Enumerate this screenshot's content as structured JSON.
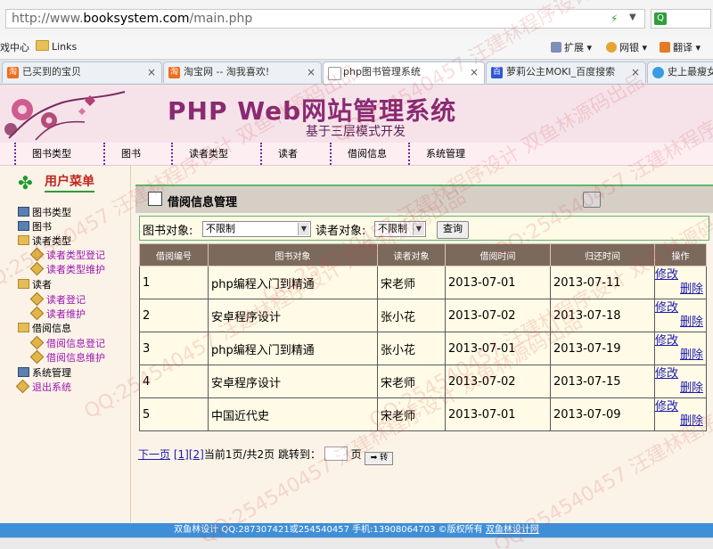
{
  "browser": {
    "url_prefix": "http://www.",
    "url_host": "booksystem.com",
    "url_path": "/main.php",
    "bookmarks": [
      {
        "label": "戏中心"
      },
      {
        "label": "Links"
      }
    ],
    "toolbar": [
      {
        "label": "扩展"
      },
      {
        "label": "网银"
      },
      {
        "label": "翻译"
      }
    ],
    "tabs": [
      {
        "label": "已买到的宝贝"
      },
      {
        "label": "淘宝网 -- 淘我喜欢!"
      },
      {
        "label": "php图书管理系统"
      },
      {
        "label": "萝莉公主MOKI_百度搜索"
      },
      {
        "label": "史上最瘦女"
      }
    ]
  },
  "banner": {
    "title": "PHP Web网站管理系统",
    "subtitle": "基于三层模式开发"
  },
  "nav": [
    "图书类型",
    "图书",
    "读者类型",
    "读者",
    "借阅信息",
    "系统管理"
  ],
  "sidebar": {
    "title": "用户菜单",
    "items": [
      {
        "label": "图书类型",
        "level": "top",
        "icon": "book"
      },
      {
        "label": "图书",
        "level": "top",
        "icon": "book"
      },
      {
        "label": "读者类型",
        "level": "top",
        "icon": "folder"
      },
      {
        "label": "读者类型登记",
        "level": "sub",
        "icon": "diamond"
      },
      {
        "label": "读者类型维护",
        "level": "sub",
        "icon": "diamond"
      },
      {
        "label": "读者",
        "level": "top",
        "icon": "folder"
      },
      {
        "label": "读者登记",
        "level": "sub",
        "icon": "diamond"
      },
      {
        "label": "读者维护",
        "level": "sub",
        "icon": "diamond"
      },
      {
        "label": "借阅信息",
        "level": "top",
        "icon": "folder"
      },
      {
        "label": "借阅信息登记",
        "level": "sub",
        "icon": "diamond"
      },
      {
        "label": "借阅信息维护",
        "level": "sub",
        "icon": "diamond"
      },
      {
        "label": "系统管理",
        "level": "top",
        "icon": "book"
      },
      {
        "label": "退出系统",
        "level": "exit",
        "icon": "diamond"
      }
    ]
  },
  "panel": {
    "title": "借阅信息管理",
    "filter": {
      "book_label": "图书对象:",
      "book_value": "不限制",
      "reader_label": "读者对象:",
      "reader_value": "不限制",
      "query_label": "查询"
    },
    "columns": [
      "借阅编号",
      "图书对象",
      "读者对象",
      "借阅时间",
      "归还时间",
      "操作"
    ],
    "rows": [
      {
        "id": "1",
        "book": "php编程入门到精通",
        "reader": "宋老师",
        "borrow": "2013-07-01",
        "return": "2013-07-11",
        "edit": "修改",
        "del": "删除"
      },
      {
        "id": "2",
        "book": "安卓程序设计",
        "reader": "张小花",
        "borrow": "2013-07-02",
        "return": "2013-07-18",
        "edit": "修改",
        "del": "删除"
      },
      {
        "id": "3",
        "book": "php编程入门到精通",
        "reader": "张小花",
        "borrow": "2013-07-01",
        "return": "2013-07-19",
        "edit": "修改",
        "del": "删除"
      },
      {
        "id": "4",
        "book": "安卓程序设计",
        "reader": "宋老师",
        "borrow": "2013-07-02",
        "return": "2013-07-15",
        "edit": "修改",
        "del": "删除"
      },
      {
        "id": "5",
        "book": "中国近代史",
        "reader": "宋老师",
        "borrow": "2013-07-01",
        "return": "2013-07-09",
        "edit": "修改",
        "del": "删除"
      }
    ]
  },
  "pagination": {
    "next": "下一页",
    "page1": "[1]",
    "page2": "[2]",
    "info": "当前1页/共2页 跳转到：",
    "page_unit": "页",
    "go_label": "➡ 转"
  },
  "footer": {
    "text": "双鱼林设计 QQ:287307421或254540457 手机:13908064703 ©版权所有",
    "link": "双鱼林设计网"
  },
  "watermark": {
    "lines": [
      "QQ:254540457 汪建林程序设计 双鱼林源码出品"
    ]
  }
}
